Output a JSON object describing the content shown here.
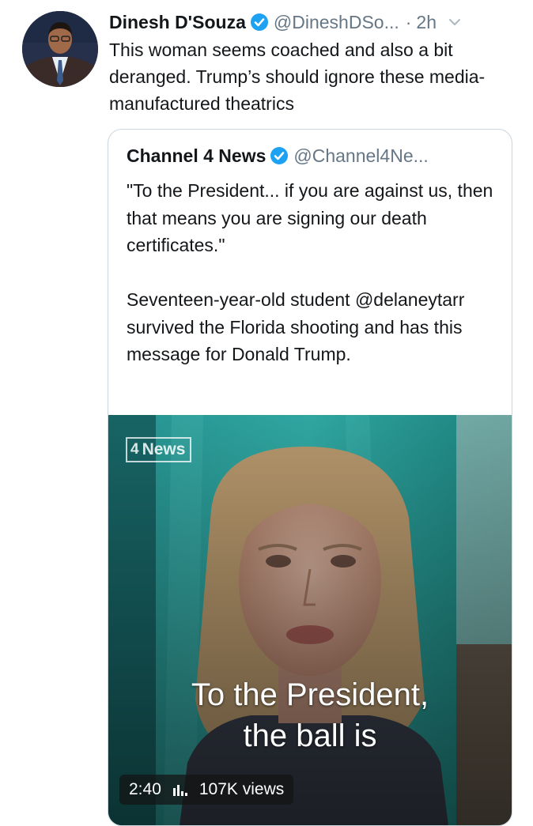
{
  "tweet": {
    "author_name": "Dinesh D'Souza",
    "handle": "@DineshDSo...",
    "separator": "·",
    "time": "2h",
    "text": "This woman seems coached and also a bit deranged.  Trump’s should ignore these media-manufactured theatrics",
    "avatar_icon": "person-avatar",
    "verified_icon": "verified-badge-icon",
    "menu_icon": "chevron-down-icon"
  },
  "quoted": {
    "author_name": "Channel 4 News",
    "handle": "@Channel4Ne...",
    "paragraph1": "\"To the President... if you are against us, then that means you are signing our death certificates.\"",
    "paragraph2": "Seventeen-year-old student @delaneytarr survived the Florida shooting and has this message for Donald Trump."
  },
  "media": {
    "logo_mark": "4",
    "logo_text": "News",
    "caption_line1": "To the President,",
    "caption_line2": "the ball is",
    "duration": "2:40",
    "views": "107K views",
    "stats_icon": "bar-chart-icon"
  },
  "colors": {
    "verified": "#1da1f2",
    "secondary_text": "#657786",
    "border": "#ccd6dd"
  }
}
